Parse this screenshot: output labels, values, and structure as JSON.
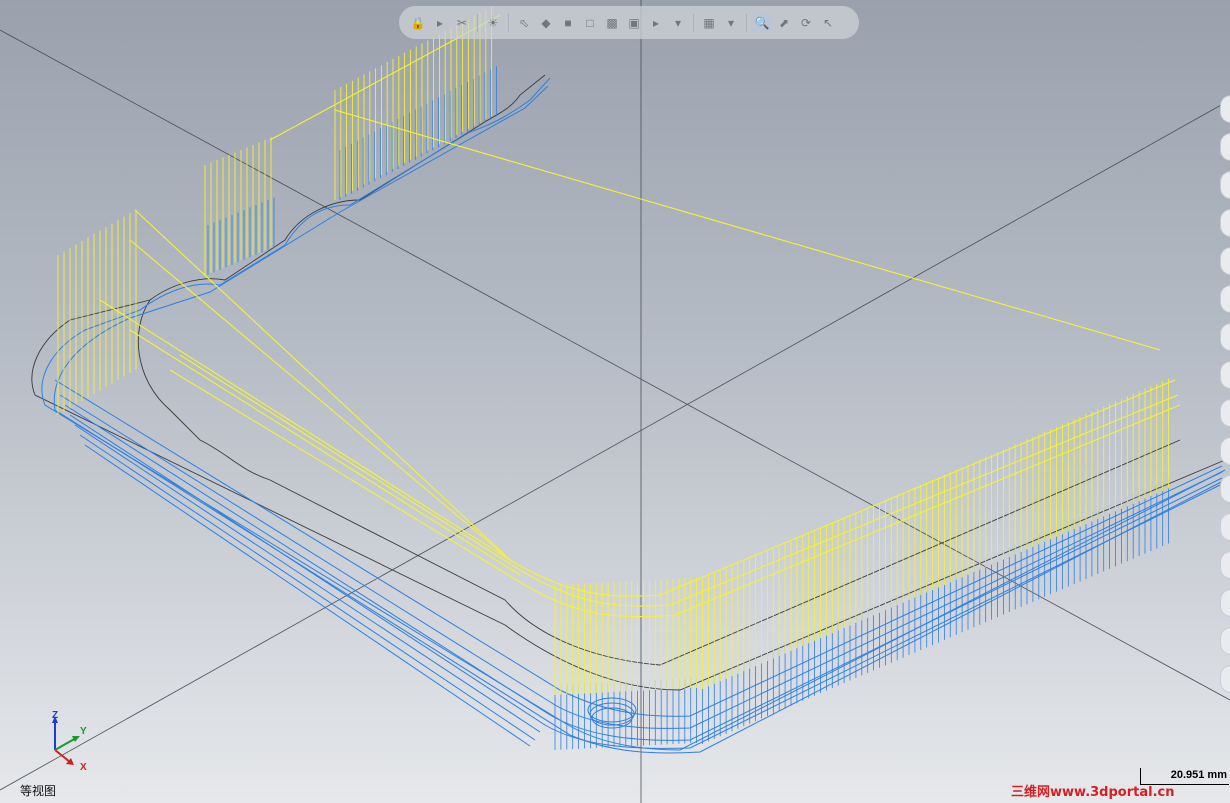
{
  "view": {
    "name": "等视图"
  },
  "axes": {
    "z": "Z",
    "y": "Y",
    "x": "X"
  },
  "scale": {
    "value": "20.951 mm"
  },
  "watermark": "三维网www.3dportal.cn",
  "toolbar": {
    "icons": [
      "lock-icon",
      "select-filter-icon",
      "cut-icon",
      "light-icon",
      "display-style-icon",
      "shaded-icon",
      "wireframe-icon",
      "hidden-line-icon",
      "view-cube-icon",
      "view-orient-icon",
      "section-icon",
      "zoom-icon",
      "zoom-fit-icon",
      "rotate-icon",
      "pan-icon"
    ]
  },
  "colors": {
    "toolpath_rapid": "#f5f233",
    "toolpath_cut": "#2f7fe0",
    "geometry": "#3b3b3b"
  }
}
